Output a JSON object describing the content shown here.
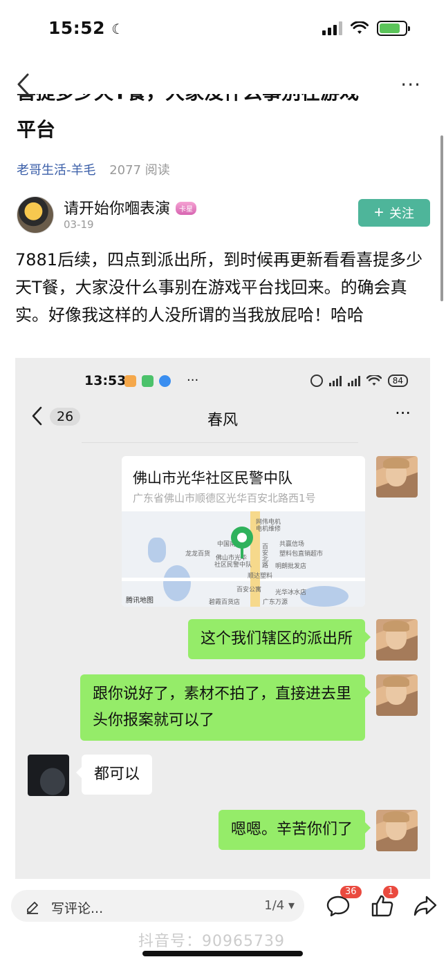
{
  "status_bar": {
    "time": "15:52",
    "moon": "☾"
  },
  "nav": {
    "more": "···"
  },
  "article": {
    "title_partial": "喜提多少天T餐，大家没什么事别在游戏",
    "title_line2": "平台",
    "author_link": "老哥生活-羊毛",
    "reads": "2077 阅读"
  },
  "user": {
    "name": "请开始你嗰表演",
    "badge": "卡星",
    "date": "03-19",
    "follow_label": "关注",
    "follow_icon": "+"
  },
  "body_text": "7881后续，四点到派出所，到时候再更新看看喜提多少天T餐，大家没什么事别在游戏平台找回来。的确会真实。好像我这样的人没所谓的当我放屁哈！哈哈",
  "screenshot": {
    "status_time": "13:53",
    "status_dots": "···",
    "battery": "84",
    "chat_count": "26",
    "chat_title": "春风",
    "chat_more": "···",
    "location": {
      "name": "佛山市光华社区民警中队",
      "address": "广东省佛山市顺德区光华百安北路西1号",
      "map_labels": {
        "l1": "网伟电机",
        "l2": "电机维修",
        "l3": "中国南方",
        "l4": "龙龙百货",
        "l5": "佛山市光华",
        "l6": "社区民警中队",
        "l7": "共赢信场",
        "l8": "塑料包直销超市",
        "l9": "明朗批发店",
        "l10": "顺达塑料",
        "l11": "百安公寓",
        "l12": "光华冰水店",
        "l13": "碧霞百货店",
        "l14": "广东万源",
        "road": "百安北路",
        "tencent": "腾讯地图"
      }
    },
    "messages": [
      {
        "side": "me",
        "text": "这个我们辖区的派出所"
      },
      {
        "side": "me",
        "text": "跟你说好了，素材不拍了，直接进去里头你报案就可以了"
      },
      {
        "side": "other",
        "text": "都可以"
      },
      {
        "side": "me",
        "text": "嗯嗯。辛苦你们了"
      }
    ]
  },
  "bottom_bar": {
    "comment_placeholder": "写评论...",
    "page_counter": "1/4 ▾",
    "comment_badge": "36",
    "like_badge": "1"
  },
  "watermark": "抖音号：90965739",
  "colors": {
    "accent_green": "#4eb59a",
    "link_blue": "#3a5ea8",
    "wechat_bubble": "#95ec69",
    "badge_red": "#ea4a3f"
  }
}
